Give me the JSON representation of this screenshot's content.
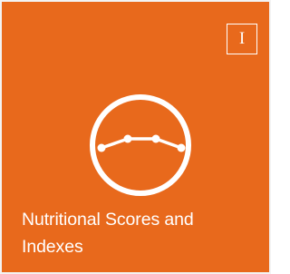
{
  "tile": {
    "badge_letter": "I",
    "label": "Nutritional Scores and Indexes",
    "icon": "gauge-curve-icon",
    "background_color": "#e8691c",
    "foreground_color": "#ffffff"
  }
}
